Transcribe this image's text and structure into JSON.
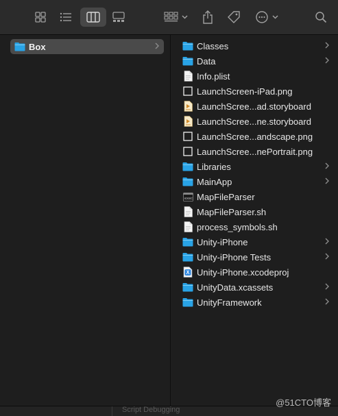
{
  "sidebar": {
    "items": [
      {
        "label": "Box",
        "icon": "folder-icon"
      }
    ]
  },
  "files": [
    {
      "label": "Classes",
      "icon": "folder-icon",
      "chevron": true
    },
    {
      "label": "Data",
      "icon": "folder-icon",
      "chevron": true
    },
    {
      "label": "Info.plist",
      "icon": "document-icon",
      "chevron": false
    },
    {
      "label": "LaunchScreen-iPad.png",
      "icon": "image-file-icon",
      "chevron": false
    },
    {
      "label": "LaunchScree...ad.storyboard",
      "icon": "storyboard-file-icon",
      "chevron": false
    },
    {
      "label": "LaunchScree...ne.storyboard",
      "icon": "storyboard-file-icon",
      "chevron": false
    },
    {
      "label": "LaunchScree...andscape.png",
      "icon": "image-file-icon",
      "chevron": false
    },
    {
      "label": "LaunchScree...nePortrait.png",
      "icon": "image-file-icon",
      "chevron": false
    },
    {
      "label": "Libraries",
      "icon": "folder-icon",
      "chevron": true
    },
    {
      "label": "MainApp",
      "icon": "folder-icon",
      "chevron": true
    },
    {
      "label": "MapFileParser",
      "icon": "executable-icon",
      "chevron": false
    },
    {
      "label": "MapFileParser.sh",
      "icon": "document-icon",
      "chevron": false
    },
    {
      "label": "process_symbols.sh",
      "icon": "document-icon",
      "chevron": false
    },
    {
      "label": "Unity-iPhone",
      "icon": "folder-icon",
      "chevron": true
    },
    {
      "label": "Unity-iPhone Tests",
      "icon": "folder-icon",
      "chevron": true
    },
    {
      "label": "Unity-iPhone.xcodeproj",
      "icon": "xcodeproj-icon",
      "chevron": false
    },
    {
      "label": "UnityData.xcassets",
      "icon": "folder-icon",
      "chevron": true
    },
    {
      "label": "UnityFramework",
      "icon": "folder-icon",
      "chevron": true
    }
  ],
  "bottom": {
    "text": "Script Debugging"
  },
  "watermark": "@51CTO博客",
  "colors": {
    "folder": "#29a3e6",
    "selection": "#4a4a4a",
    "background": "#1e1e1e",
    "toolbar": "#2b2b2b"
  }
}
